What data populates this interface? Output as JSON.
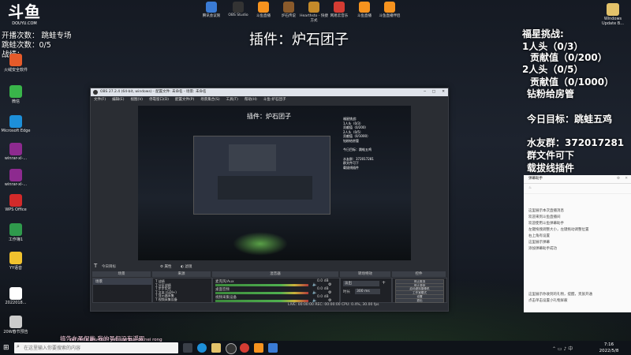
{
  "top_left": {
    "logo_text": "斗鱼",
    "logo_sub": "DOUYU.COM",
    "line1": "开播次数：  跳蛙专场",
    "line2": "跳蛙次数：0/5",
    "line3": "战绩："
  },
  "center_title": "插件：炉石团子",
  "right_overlay": {
    "challenge_title": "福星挑战:",
    "c1_heads": "1人头（0/3）",
    "c1_value": "贡献值（0/200）",
    "c2_heads": "2人头（0/5）",
    "c2_value": "贡献值（0/1000）",
    "fan_line": "钻粉给房管",
    "goal": "今日目标：跳蛙五鸡",
    "qq_group": "水友群：372017281",
    "file_line": "群文件可下",
    "plugin_line": "载拔线插件"
  },
  "desktop_icons": [
    {
      "label": "火绒安全软件",
      "color": "#e65b2a"
    },
    {
      "label": "微信",
      "color": "#39b54a"
    },
    {
      "label": "Microsoft Edge",
      "color": "#1d8fd9"
    },
    {
      "label": "winrar-xl-...",
      "color": "#8d2a8f"
    },
    {
      "label": "winrar-xl-...",
      "color": "#8d2a8f"
    },
    {
      "label": "WPS Office",
      "color": "#d22a2a"
    },
    {
      "label": "工作簿1",
      "color": "#2f9a4c"
    },
    {
      "label": "YY语音",
      "color": "#f1c22e"
    },
    {
      "label": "2022018...",
      "color": "#ffffff"
    },
    {
      "label": "20W春节预告",
      "color": "#cccccc"
    }
  ],
  "top_icons": [
    {
      "label": "腾讯会议限",
      "color": "#3a7bd5"
    },
    {
      "label": "OBS Studio",
      "color": "#333333"
    },
    {
      "label": "斗鱼直播",
      "color": "#f7931e"
    },
    {
      "label": "炉石传说",
      "color": "#8a5a2b"
    },
    {
      "label": "Hearthsto - 快捷方式",
      "color": "#c48a2a"
    },
    {
      "label": "网易云音乐",
      "color": "#d43c33"
    },
    {
      "label": "斗鱼直播",
      "color": "#f7931e"
    },
    {
      "label": "斗鱼直播伴侣",
      "color": "#f7931e"
    }
  ],
  "windows_update": "Windows Update B...",
  "obs": {
    "title": "OBS 27.2.4 (64-bit, windows) - 配置文件: 未命名 - 场景: 未命名",
    "menu": [
      "文件(F)",
      "编辑(E)",
      "视图(V)",
      "停靠窗口(D)",
      "配置文件(P)",
      "场景集合(S)",
      "工具(T)",
      "帮助(H)",
      "斗鱼-炉石团子"
    ],
    "scene_name": "今日目标",
    "props_btn": "属性",
    "filter_btn": "滤镜",
    "dock_titles": [
      "场景",
      "来源",
      "混音器",
      "转场特效",
      "控件"
    ],
    "scenes": [
      "场景"
    ],
    "sources": [
      "战绩",
      "分区战绩",
      "步步实时",
      "文本 (GDI+)",
      "显示器采集",
      "视频采集设备"
    ],
    "mixer_tracks": [
      "麦克风/Aux",
      "桌面音频",
      "视频采集设备"
    ],
    "mixer_db": [
      "0.0 dB",
      "0.0 dB",
      "0.0 dB"
    ],
    "transition": "淡出",
    "duration_label": "时长",
    "duration_value": "300 ms",
    "controls": [
      "停止推流",
      "停止录制",
      "启动虚拟摄像机",
      "工作室模式",
      "设置",
      "退出"
    ],
    "status": "LIVE: 00:00:00   REC: 00:00:00   CPU: 0.4%, 30.00 fps"
  },
  "chat": {
    "header": "弹幕助手",
    "msgs": [
      "这里展示本次直播消息",
      "欢迎来到斗鱼直播间",
      "欢迎使用斗鱼弹幕助手",
      "左键拖拽调整大小，左键拖动调整位置",
      "右上角有设置",
      "这里展示弹幕",
      "添加弹幕助手成功",
      "这里展示你收到的礼物，提醒，贵族开通",
      "点击单击设置小礼物屏蔽"
    ]
  },
  "bottom_caption": "搞告在圣侃能 我的圣侃没有浮现",
  "taskbar": {
    "search_placeholder": "在这里输入你要搜索的内容",
    "ime_text": "zai zhe li shu ru ni yao sou suo de nei rong",
    "time": "7:16",
    "date": "2022/5/8"
  }
}
